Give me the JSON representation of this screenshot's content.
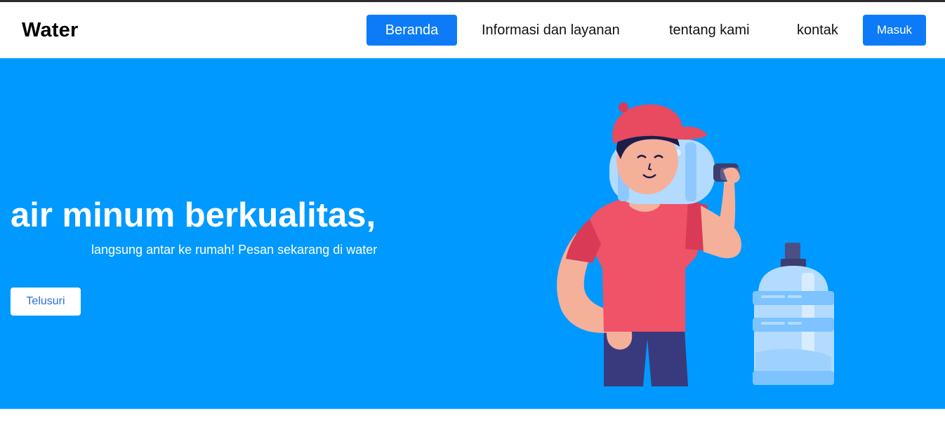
{
  "navbar": {
    "brand": "Water",
    "items": [
      {
        "label": "Beranda",
        "active": true
      },
      {
        "label": "Informasi dan layanan"
      },
      {
        "label": "tentang kami"
      },
      {
        "label": "kontak"
      }
    ],
    "login_label": "Masuk"
  },
  "hero": {
    "title": "air minum berkualitas,",
    "subtitle": "langsung antar ke rumah! Pesan sekarang di water",
    "cta_label": "Telusuri",
    "illustration": "delivery-man-carrying-water-gallon"
  },
  "colors": {
    "primary": "#0d7bf7",
    "hero_background": "#0099ff",
    "text_dark": "#111111",
    "white": "#ffffff"
  }
}
